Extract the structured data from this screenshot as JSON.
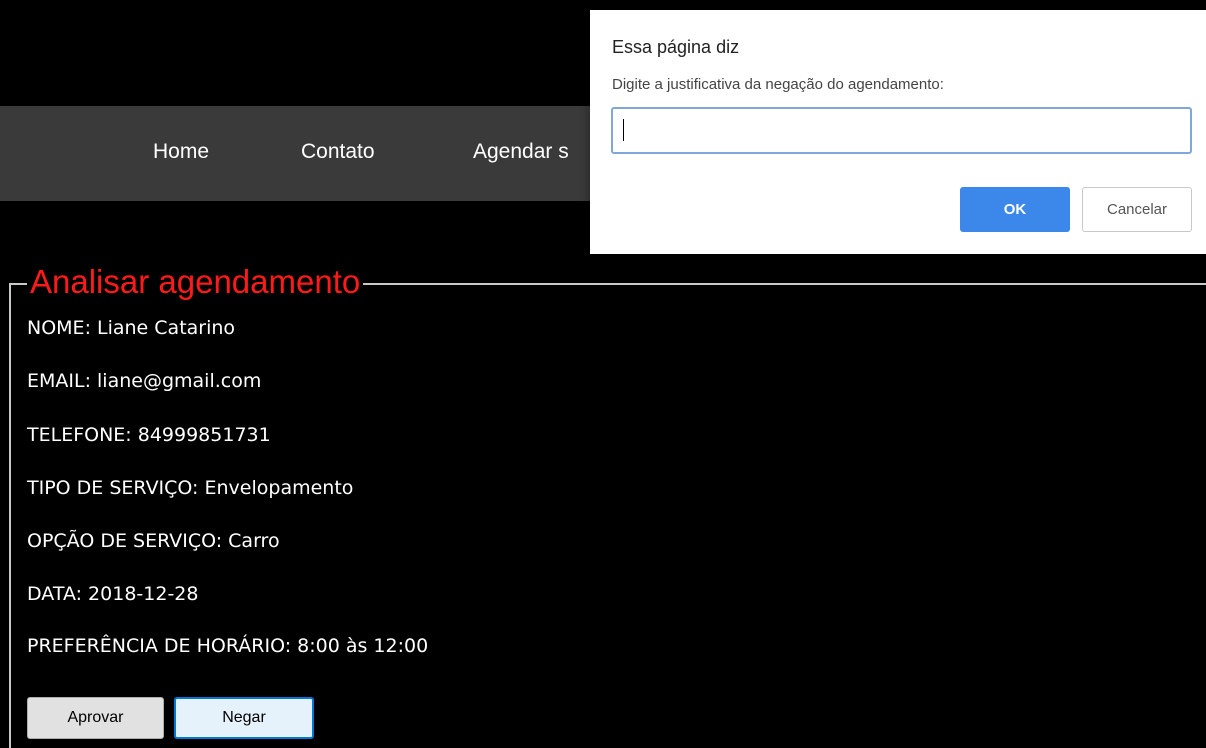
{
  "nav": {
    "items": [
      "Home",
      "Contato",
      "Agendar s"
    ]
  },
  "section": {
    "legend": "Analisar agendamento",
    "lines": [
      "NOME: Liane Catarino",
      "EMAIL: liane@gmail.com",
      "TELEFONE: 84999851731",
      "TIPO DE SERVIÇO: Envelopamento",
      "OPÇÃO DE SERVIÇO: Carro",
      "DATA: 2018-12-28",
      "PREFERÊNCIA DE HORÁRIO: 8:00 às 12:00"
    ],
    "approve_label": "Aprovar",
    "deny_label": "Negar"
  },
  "dialog": {
    "title": "Essa página diz",
    "message": "Digite a justificativa da negação do agendamento:",
    "input_value": "",
    "ok_label": "OK",
    "cancel_label": "Cancelar"
  },
  "colors": {
    "background": "#000000",
    "navbar": "#3a3a3a",
    "legend": "#ff1a1a",
    "ok_button": "#3b87ea"
  }
}
